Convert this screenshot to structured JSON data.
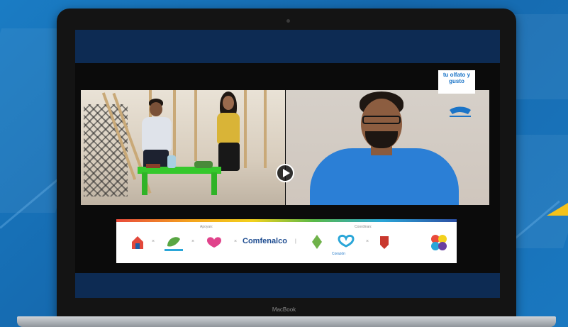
{
  "colors": {
    "background": "#1670b5",
    "screen_bar": "#0d2b53",
    "accent": "#f5c21a",
    "table": "#35c82c",
    "shirt_blue": "#2b7fd6",
    "comfenalco_blue": "#1f4d91"
  },
  "laptop": {
    "brand": "MacBook"
  },
  "video": {
    "left_caption": "",
    "right_caption": "",
    "play_icon": "play-icon"
  },
  "promo": {
    "line1": "",
    "line2": "tu olfato y gusto"
  },
  "sponsors": {
    "section_left_title": "Apoyan:",
    "section_right_title": "Coordinan:",
    "comfenalco_name": "Comfenalco",
    "comfenalco_sub": "",
    "corazon": "Corazón"
  }
}
